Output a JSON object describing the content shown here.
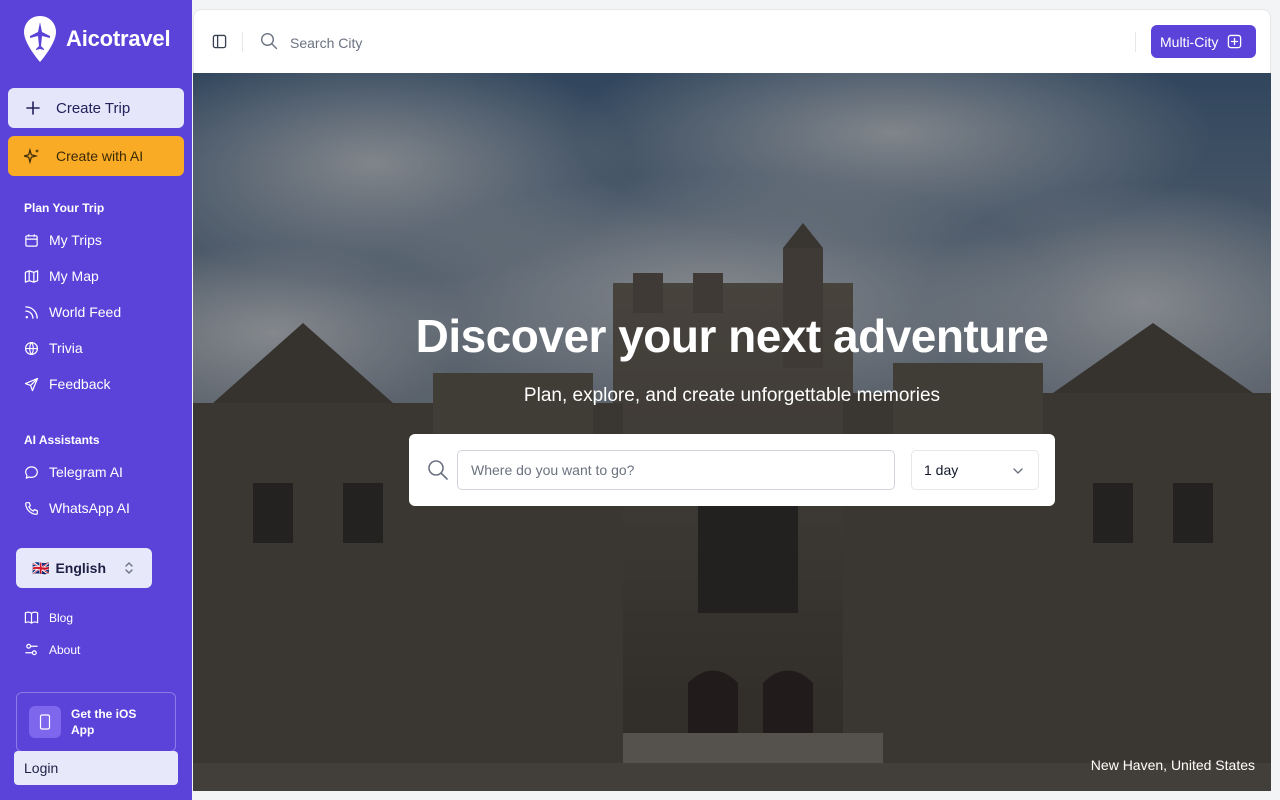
{
  "brand": {
    "name": "Aicotravel",
    "accent": "#5b43d9",
    "ai_button_color": "#f9ab25"
  },
  "sidebar": {
    "create_trip": "Create Trip",
    "create_ai": "Create with AI",
    "section_plan": "Plan Your Trip",
    "plan_items": [
      {
        "label": "My Trips",
        "icon": "calendar-icon"
      },
      {
        "label": "My Map",
        "icon": "map-icon"
      },
      {
        "label": "World Feed",
        "icon": "rss-icon"
      },
      {
        "label": "Trivia",
        "icon": "globe-icon"
      },
      {
        "label": "Feedback",
        "icon": "send-icon"
      }
    ],
    "section_ai": "AI Assistants",
    "ai_items": [
      {
        "label": "Telegram AI",
        "icon": "chat-icon"
      },
      {
        "label": "WhatsApp AI",
        "icon": "phone-icon"
      }
    ],
    "language": {
      "flag": "🇬🇧",
      "label": "English"
    },
    "footer_items": [
      {
        "label": "Blog",
        "icon": "book-icon"
      },
      {
        "label": "About",
        "icon": "settings-icon"
      }
    ],
    "ios": "Get the iOS App",
    "login": "Login"
  },
  "topbar": {
    "search_placeholder": "Search City",
    "multi_city": "Multi-City"
  },
  "hero": {
    "title": "Discover your next adventure",
    "subtitle": "Plan, explore, and create unforgettable memories",
    "search_placeholder": "Where do you want to go?",
    "duration": "1 day",
    "location": "New Haven, United States"
  }
}
